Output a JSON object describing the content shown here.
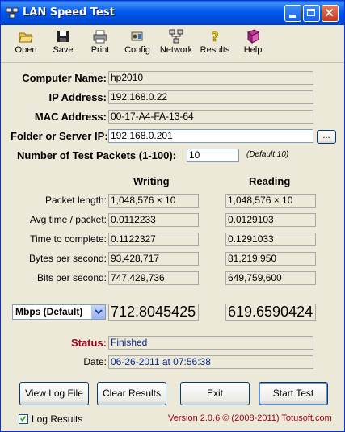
{
  "window": {
    "title": "LAN Speed Test"
  },
  "toolbar": {
    "open": "Open",
    "save": "Save",
    "print": "Print",
    "config": "Config",
    "network": "Network",
    "results": "Results",
    "help": "Help"
  },
  "info": {
    "computer_name_label": "Computer Name:",
    "computer_name": "hp2010",
    "ip_label": "IP Address:",
    "ip": "192.168.0.22",
    "mac_label": "MAC Address:",
    "mac": "00-17-A4-FA-13-64",
    "folder_label": "Folder or Server IP:",
    "folder": "192.168.0.201",
    "browse": "...",
    "packets_label": "Number of Test Packets (1-100):",
    "packets": "10",
    "packets_default": "(Default 10)"
  },
  "results": {
    "writing_header": "Writing",
    "reading_header": "Reading",
    "rows": [
      {
        "label": "Packet length:",
        "writing": "1,048,576  × 10",
        "reading": "1,048,576  × 10"
      },
      {
        "label": "Avg time / packet:",
        "writing": "0.0112233",
        "reading": "0.0129103"
      },
      {
        "label": "Time to complete:",
        "writing": "0.1122327",
        "reading": "0.1291033"
      },
      {
        "label": "Bytes per second:",
        "writing": "93,428,717",
        "reading": "81,219,950"
      },
      {
        "label": "Bits per second:",
        "writing": "747,429,736",
        "reading": "649,759,600"
      }
    ],
    "unit": "Mbps (Default)",
    "writing_mbps": "712.8045425",
    "reading_mbps": "619.6590424"
  },
  "status": {
    "label": "Status:",
    "value": "Finished",
    "date_label": "Date:",
    "date": "06-26-2011 at 07:56:38"
  },
  "buttons": {
    "view_log": "View Log File",
    "clear": "Clear Results",
    "exit": "Exit",
    "start": "Start Test"
  },
  "footer": {
    "log_results": "Log Results",
    "version": "Version 2.0.6  © (2008-2011) Totusoft.com"
  },
  "colors": {
    "status_label": "#a0001c",
    "version_text": "#a0001c",
    "title_bar": "#0058ee"
  }
}
